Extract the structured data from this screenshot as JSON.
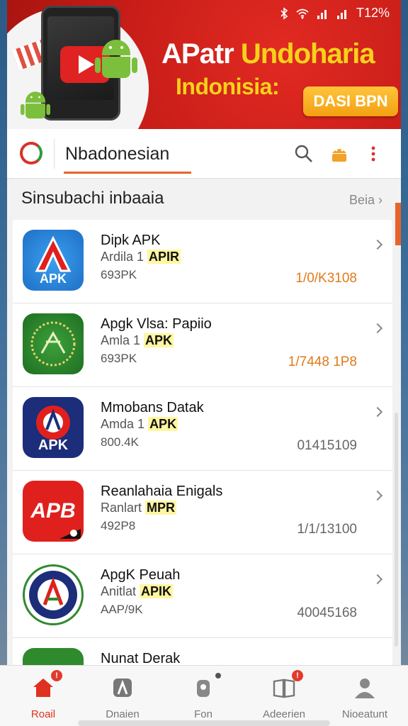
{
  "status_bar": {
    "battery": "T12%"
  },
  "banner": {
    "title_white": "APatr",
    "title_yellow": "Undoharia",
    "subtitle": "Indonisia:",
    "cta_label": "DASI BPN"
  },
  "appbar": {
    "search_value": "Nbadonesian"
  },
  "section": {
    "heading": "Sinsubachi inbaaia",
    "see_all": "Beia"
  },
  "apps": [
    {
      "name": "Dipk APK",
      "sub_prefix": "Ardila 1",
      "sub_tag": "APIR",
      "size": "693PK",
      "date": "1/0/K3108",
      "date_color": "#e07a1a",
      "icon_text": "APK",
      "icon_bg": "#1f7bd6"
    },
    {
      "name": "Apgk Vlsa: Papiio",
      "sub_prefix": "Amla 1",
      "sub_tag": "APK",
      "size": "693PK",
      "date": "1/7448 1P8",
      "date_color": "#e07a1a",
      "icon_text": "",
      "icon_bg": "#2f8a2e"
    },
    {
      "name": "Mmobans Datak",
      "sub_prefix": "Amda 1",
      "sub_tag": "APK",
      "size": "800.4K",
      "date": "01415109",
      "date_color": "#666666",
      "icon_text": "APK",
      "icon_bg": "#1c2d7a"
    },
    {
      "name": "Reanlahaia Enigals",
      "sub_prefix": "Ranlart",
      "sub_tag": "MPR",
      "size": "492P8",
      "date": "1/1/13100",
      "date_color": "#666666",
      "icon_text": "APB",
      "icon_bg": "#e0201d"
    },
    {
      "name": "ApgK Peuah",
      "sub_prefix": "Anitlat",
      "sub_tag": "APIK",
      "size": "AAP/9K",
      "date": "40045168",
      "date_color": "#666666",
      "icon_text": "",
      "icon_bg": "#1c2d7a"
    },
    {
      "name": "Nunat Derak",
      "sub_prefix": "",
      "sub_tag": "",
      "size": "",
      "date": "",
      "date_color": "#666666",
      "icon_text": "",
      "icon_bg": "#2f8a2e"
    }
  ],
  "bottom_nav": [
    {
      "label": "Roail",
      "active": true,
      "badge": "!"
    },
    {
      "label": "Dnaien",
      "active": false,
      "badge": ""
    },
    {
      "label": "Fon",
      "active": false,
      "badge": ""
    },
    {
      "label": "Adeerien",
      "active": false,
      "badge": "!"
    },
    {
      "label": "Nioeatunt",
      "active": false,
      "badge": ""
    }
  ],
  "colors": {
    "accent": "#e6642a",
    "brand_red": "#c81d18",
    "highlight": "#f6d21a"
  }
}
